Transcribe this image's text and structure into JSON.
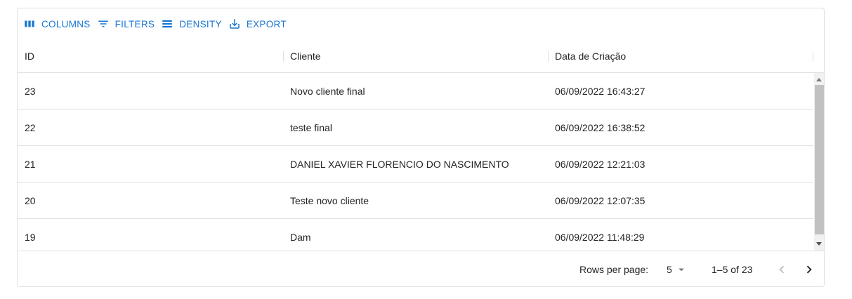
{
  "toolbar": {
    "columns_label": "COLUMNS",
    "filters_label": "FILTERS",
    "density_label": "DENSITY",
    "export_label": "EXPORT"
  },
  "columns": {
    "id": "ID",
    "cliente": "Cliente",
    "data": "Data de Criação"
  },
  "rows": [
    {
      "id": "23",
      "cliente": "Novo cliente final",
      "data": "06/09/2022 16:43:27"
    },
    {
      "id": "22",
      "cliente": "teste final",
      "data": "06/09/2022 16:38:52"
    },
    {
      "id": "21",
      "cliente": "DANIEL XAVIER FLORENCIO DO NASCIMENTO",
      "data": "06/09/2022 12:21:03"
    },
    {
      "id": "20",
      "cliente": "Teste novo cliente",
      "data": "06/09/2022 12:07:35"
    },
    {
      "id": "19",
      "cliente": "Dam",
      "data": "06/09/2022 11:48:29"
    }
  ],
  "pagination": {
    "rows_per_page_label": "Rows per page:",
    "rows_per_page_value": "5",
    "range_text": "1–5 of 23"
  },
  "colors": {
    "accent": "#1976d2",
    "border": "#e0e0e0",
    "scroll_thumb": "#c1c1c1"
  },
  "icons": {
    "columns": "view-column-icon",
    "filters": "filter-list-icon",
    "density": "density-icon",
    "export": "download-icon",
    "prev": "chevron-left-icon",
    "next": "chevron-right-icon",
    "select": "arrow-drop-down-icon"
  }
}
